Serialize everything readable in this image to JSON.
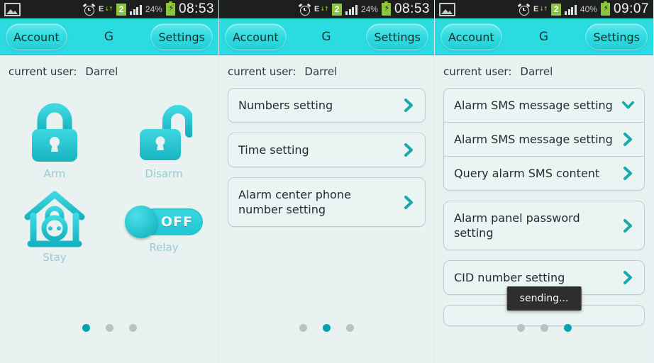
{
  "panels": [
    {
      "status_bar": {
        "photo_icon": "photo-icon",
        "alarm_icon": "alarm-clock-icon",
        "network_label": "E",
        "network_arrows": "↓↑",
        "sim_badge": "2",
        "signal_icon": "signal-bars-icon",
        "battery_percent": "24%",
        "battery_icon": "battery-charging-icon",
        "clock": "08:53"
      },
      "appbar": {
        "left_button": "Account",
        "title": "G",
        "right_button": "Settings"
      },
      "current_user_label": "current user:",
      "current_user_name": "Darrel",
      "icons": [
        {
          "label": "Arm",
          "icon": "lock-closed-icon"
        },
        {
          "label": "Disarm",
          "icon": "lock-open-icon"
        },
        {
          "label": "Stay",
          "icon": "house-lock-icon"
        },
        {
          "label": "Relay",
          "icon": "toggle-switch-icon",
          "toggle_state": "OFF"
        }
      ],
      "dots": {
        "count": 3,
        "active": 0
      }
    },
    {
      "status_bar": {
        "alarm_icon": "alarm-clock-icon",
        "network_label": "E",
        "network_arrows": "↓↑",
        "sim_badge": "2",
        "signal_icon": "signal-bars-icon",
        "battery_percent": "24%",
        "battery_icon": "battery-charging-icon",
        "clock": "08:53"
      },
      "appbar": {
        "left_button": "Account",
        "title": "G",
        "right_button": "Settings"
      },
      "current_user_label": "current user:",
      "current_user_name": "Darrel",
      "cards": [
        {
          "rows": [
            {
              "label": "Numbers setting",
              "chevron": "chevron-right-icon"
            }
          ]
        },
        {
          "rows": [
            {
              "label": "Time setting",
              "chevron": "chevron-right-icon"
            }
          ]
        },
        {
          "rows": [
            {
              "label": "Alarm center phone number setting",
              "chevron": "chevron-right-icon"
            }
          ]
        }
      ],
      "dots": {
        "count": 3,
        "active": 1
      }
    },
    {
      "status_bar": {
        "photo_icon": "photo-icon",
        "alarm_icon": "alarm-clock-icon",
        "network_label": "E",
        "network_arrows": "↓↑",
        "sim_badge": "2",
        "signal_icon": "signal-bars-icon",
        "battery_percent": "40%",
        "battery_icon": "battery-charging-icon",
        "clock": "09:07"
      },
      "appbar": {
        "left_button": "Account",
        "title": "G",
        "right_button": "Settings"
      },
      "current_user_label": "current user:",
      "current_user_name": "Darrel",
      "cards": [
        {
          "rows": [
            {
              "label": "Alarm SMS message setting",
              "chevron": "chevron-down-icon"
            },
            {
              "label": "Alarm SMS message setting",
              "chevron": "chevron-right-icon"
            },
            {
              "label": "Query alarm SMS content",
              "chevron": "chevron-right-icon"
            }
          ]
        },
        {
          "rows": [
            {
              "label": "Alarm panel password setting",
              "chevron": "chevron-right-icon"
            }
          ]
        },
        {
          "rows": [
            {
              "label": "CID number setting",
              "chevron": "chevron-right-icon"
            }
          ]
        }
      ],
      "toast": "sending...",
      "dots": {
        "count": 3,
        "active": 2
      }
    }
  ],
  "colors": {
    "accent_cyan": "#2adbe0",
    "chevron_teal": "#18a9ae",
    "dot_active": "#00a2ad",
    "dot_inactive": "#b7c3c3",
    "page_background": "#e9f2f1",
    "status_bar": "#1d1f1e",
    "sim_green": "#8cc63e",
    "toast_background": "#2e2e2e"
  }
}
